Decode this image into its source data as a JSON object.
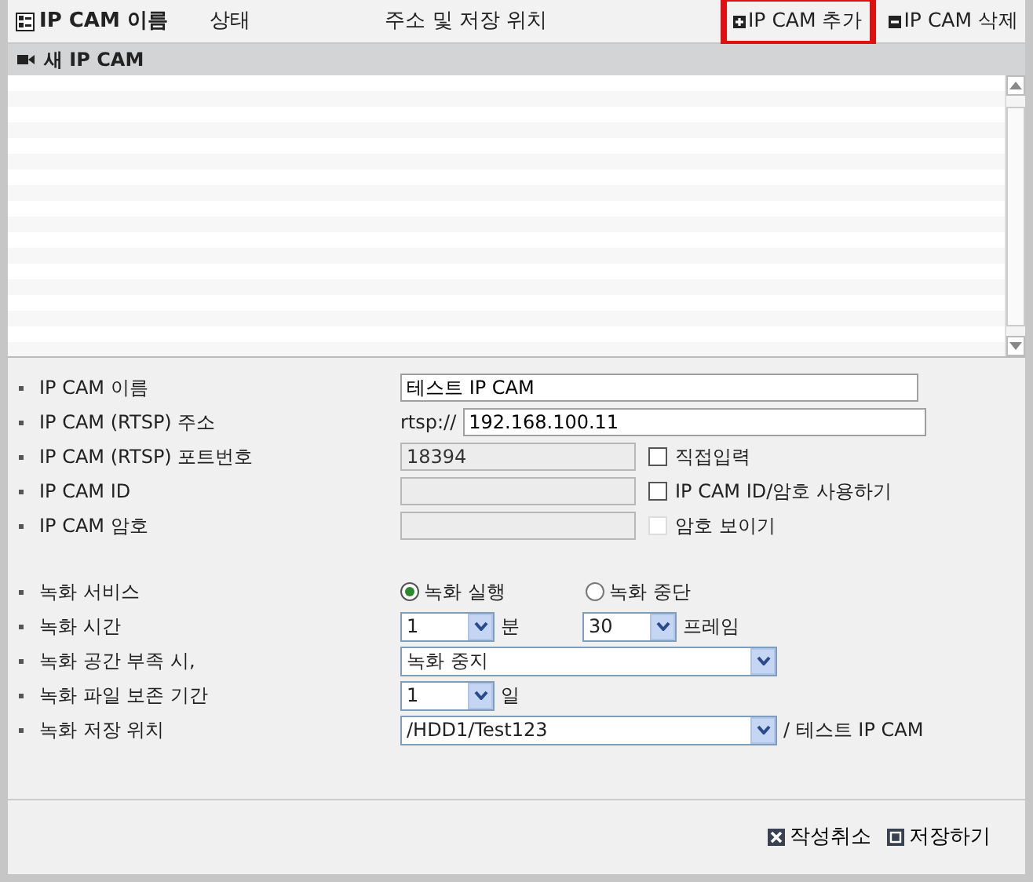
{
  "header": {
    "columns": [
      {
        "label": "IP CAM 이름"
      },
      {
        "label": "상태"
      },
      {
        "label": "주소 및 저장 위치"
      }
    ],
    "actions": [
      {
        "label": "IP CAM 추가",
        "kind": "add",
        "highlighted": true
      },
      {
        "label": "IP CAM 삭제",
        "kind": "remove",
        "highlighted": false
      }
    ]
  },
  "group": {
    "label": "새 IP CAM"
  },
  "form": {
    "sections": [
      {
        "fields": [
          {
            "kind": "text",
            "label": "IP CAM 이름",
            "value": "테스트 IP CAM",
            "disabled": false
          },
          {
            "kind": "text",
            "label": "IP CAM (RTSP) 주소",
            "prefix": "rtsp://",
            "value": "192.168.100.11",
            "disabled": false
          },
          {
            "kind": "text",
            "label": "IP CAM (RTSP) 포트번호",
            "value": "18394",
            "disabled": true,
            "checkbox": {
              "label": "직접입력",
              "checked": false,
              "disabled": false
            }
          },
          {
            "kind": "text",
            "label": "IP CAM ID",
            "disabled": true,
            "checkbox": {
              "label": "IP CAM ID/암호 사용하기",
              "checked": false,
              "disabled": false
            }
          },
          {
            "kind": "text",
            "label": "IP CAM 암호",
            "disabled": true,
            "checkbox": {
              "label": "암호 보이기",
              "checked": false,
              "disabled": true
            }
          }
        ]
      },
      {
        "fields": [
          {
            "kind": "radio",
            "label": "녹화 서비스",
            "options": [
              {
                "label": "녹화 실행",
                "selected": true
              },
              {
                "label": "녹화 중단",
                "selected": false
              }
            ]
          },
          {
            "kind": "select",
            "label": "녹화 시간",
            "selects": [
              {
                "value": "1",
                "unit": "분",
                "kind": "narrow"
              },
              {
                "value": "30",
                "unit": "프레임",
                "kind": "narrow"
              }
            ]
          },
          {
            "kind": "select",
            "label": "녹화 공간 부족 시,",
            "selects": [
              {
                "value": "녹화 중지",
                "kind": "wide"
              }
            ]
          },
          {
            "kind": "select",
            "label": "녹화 파일 보존 기간",
            "selects": [
              {
                "value": "1",
                "unit": "일",
                "kind": "narrow"
              }
            ]
          },
          {
            "kind": "select",
            "label": "녹화 저장 위치",
            "selects": [
              {
                "value": "/HDD1/Test123",
                "unit": "/ 테스트 IP CAM",
                "kind": "wide"
              }
            ]
          }
        ]
      }
    ]
  },
  "footer": {
    "buttons": [
      {
        "label": "작성취소",
        "kind": "cancel"
      },
      {
        "label": "저장하기",
        "kind": "save"
      }
    ]
  }
}
